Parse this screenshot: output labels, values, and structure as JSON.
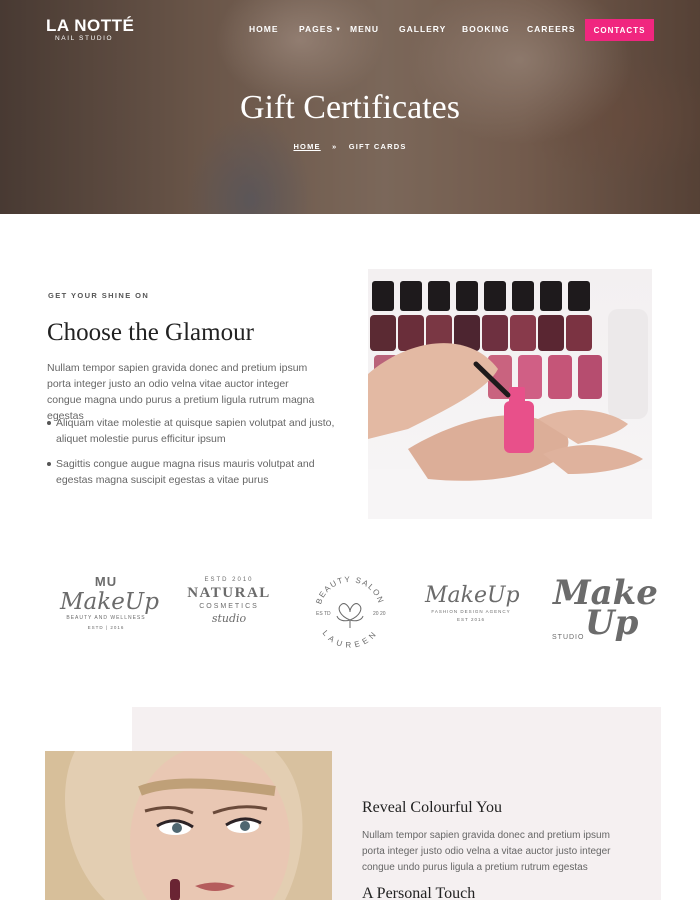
{
  "header": {
    "logo_title": "LA NOTTÉ",
    "logo_subtitle": "NAIL STUDIO",
    "nav": [
      "HOME",
      "PAGES",
      "MENU",
      "GALLERY",
      "BOOKING",
      "CAREERS"
    ],
    "contacts_label": "CONTACTS",
    "accent_color": "#f0267f"
  },
  "hero": {
    "title": "Gift Certificates",
    "breadcrumb": {
      "home": "HOME",
      "separator": "»",
      "current": "GIFT CARDS"
    }
  },
  "intro": {
    "eyebrow": "GET YOUR SHINE ON",
    "heading": "Choose the Glamour",
    "paragraph": "Nullam tempor sapien gravida donec and pretium ipsum porta integer justo an odio velna vitae auctor integer congue magna undo purus a pretium ligula rutrum magna egestas",
    "bullets": [
      "Aliquam vitae molestie at quisque sapien volutpat and justo, aliquet molestie purus efficitur ipsum",
      "Sagittis congue augue magna risus mauris volutpat and egestas magna suscipit egestas a vitae purus"
    ]
  },
  "brands": {
    "b1": {
      "top": "MU",
      "script": "MakeUp",
      "tagline": "BEAUTY AND WELLNESS",
      "est": "ESTD | 2016"
    },
    "b2": {
      "est": "ESTD 2010",
      "name": "NATURAL",
      "sub": "COSMETICS",
      "script": "studio"
    },
    "b3": {
      "arc_top": "BEAUTY SALON",
      "arc_bottom": "LAUREEN",
      "left": "ES TD",
      "right": "20 20"
    },
    "b4": {
      "script": "MakeUp",
      "tagline": "FASHION DESIGN AGENCY",
      "est": "EST 2016"
    },
    "b5": {
      "make": "Make",
      "up": "Up",
      "studio": "STUDIO"
    }
  },
  "feature": {
    "heading": "Reveal Colourful You",
    "paragraph": "Nullam tempor sapien gravida donec and pretium ipsum porta integer justo odio velna a vitae auctor justo integer congue undo purus ligula a pretium rutrum egestas",
    "heading2": "A Personal Touch"
  }
}
